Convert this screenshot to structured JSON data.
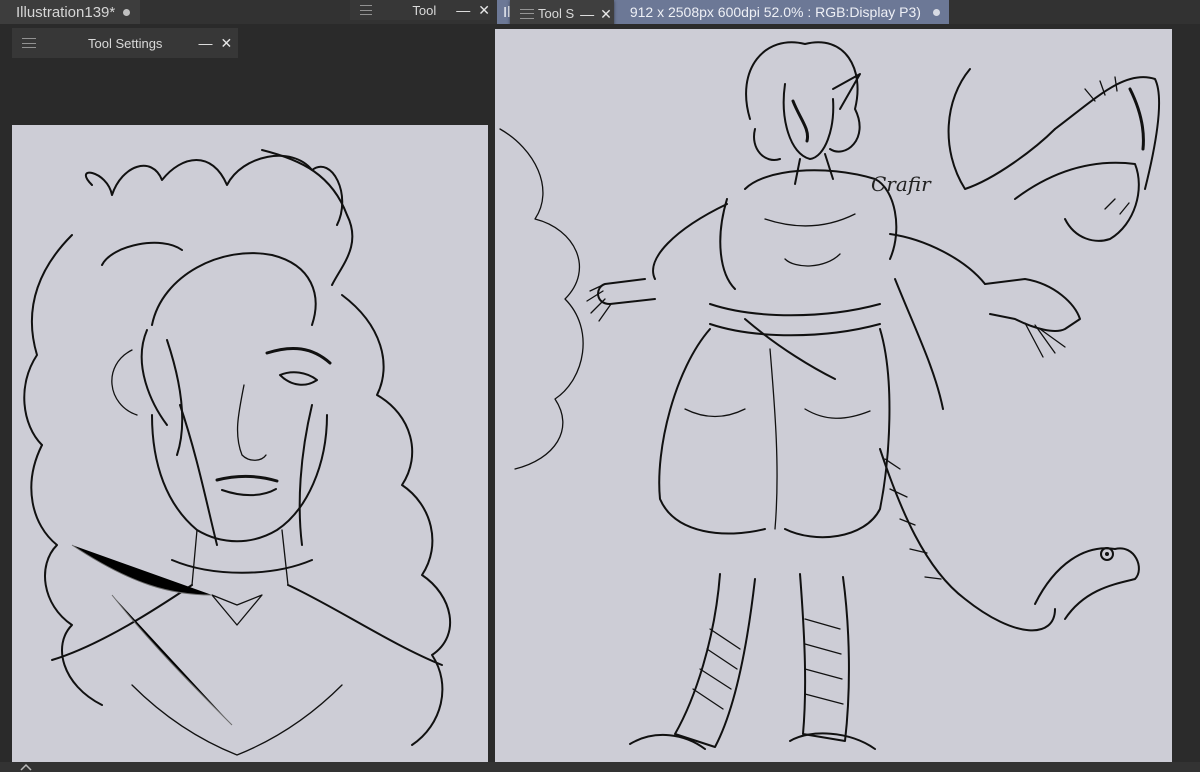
{
  "tabs": {
    "left_name": "Illustration139*",
    "right_prefix": "Ill",
    "right_info": "912 x 2508px 600dpi 52.0% : RGB:Display P3)"
  },
  "panels": {
    "tool": "Tool",
    "tool_settings": "Tool Settings",
    "tool_settings_short": "Tool S"
  },
  "controls": {
    "minimize": "—",
    "close": "✕"
  },
  "artwork": {
    "signature": "Crafir"
  },
  "colors": {
    "canvas": "#cdcdd6",
    "workspace": "#2b2b2b",
    "active_tab": "#6c7896"
  }
}
